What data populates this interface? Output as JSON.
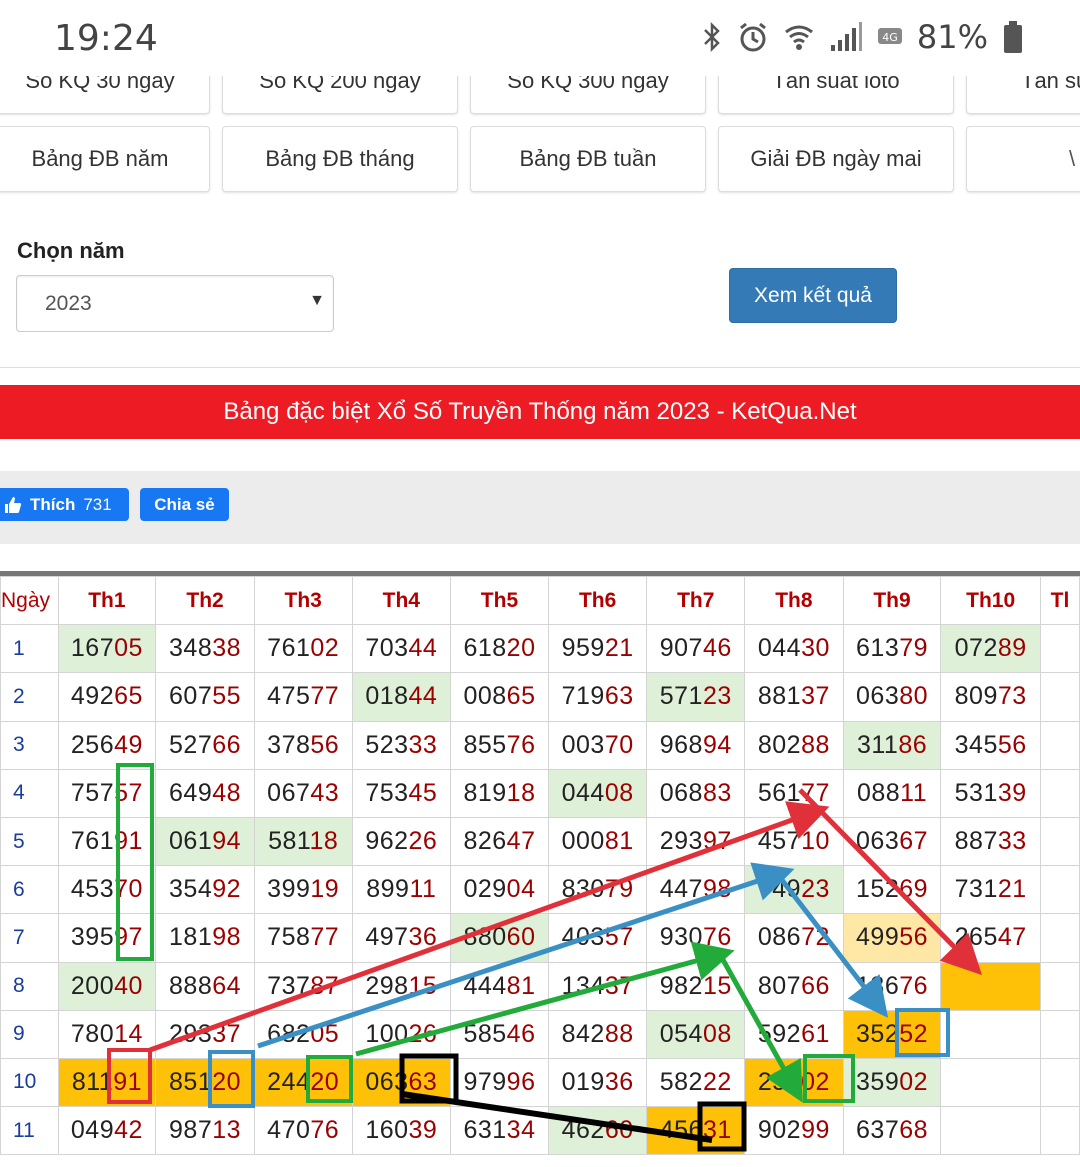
{
  "status_bar": {
    "time": "19:24",
    "battery": "81%",
    "icons": [
      "bluetooth-icon",
      "alarm-icon",
      "wifi-icon",
      "signal-icon",
      "4g-icon",
      "battery-icon"
    ]
  },
  "nav_buttons": {
    "row1": [
      "Số KQ 30 ngày",
      "Số KQ 200 ngày",
      "Số KQ 300 ngày",
      "Tần suất loto",
      "Tần su"
    ],
    "row2": [
      "Bảng ĐB năm",
      "Bảng ĐB tháng",
      "Bảng ĐB tuần",
      "Giải ĐB ngày mai",
      "\\"
    ]
  },
  "year_picker": {
    "label": "Chọn năm",
    "selected": "2023",
    "submit": "Xem kết quả"
  },
  "banner_title": "Bảng đặc biệt Xổ Số Truyền Thống năm 2023 - KetQua.Net",
  "social": {
    "like_label": "Thích",
    "like_count": "731",
    "share_label": "Chia sẻ"
  },
  "colors": {
    "banner": "#ed1c24",
    "header_text": "#b20000",
    "tail_digits": "#9b0000",
    "highlight_green": "#dff0d8",
    "highlight_orange": "#ffc107",
    "button_blue": "#337ab7",
    "facebook_blue": "#1877f2",
    "arrow_red": "#e0303a",
    "arrow_blue": "#3a8fc4",
    "arrow_green": "#22aa3a",
    "arrow_black": "#000000"
  },
  "table": {
    "headers": [
      "Ngày",
      "Th1",
      "Th2",
      "Th3",
      "Th4",
      "Th5",
      "Th6",
      "Th7",
      "Th8",
      "Th9",
      "Th10",
      "Tl"
    ],
    "rows": [
      {
        "day": "1",
        "values": [
          "16705",
          "34838",
          "76102",
          "70344",
          "61820",
          "95921",
          "90746",
          "04430",
          "61379",
          "07289",
          ""
        ]
      },
      {
        "day": "2",
        "values": [
          "49265",
          "60755",
          "47577",
          "01844",
          "00865",
          "71963",
          "57123",
          "88137",
          "06380",
          "80973",
          ""
        ]
      },
      {
        "day": "3",
        "values": [
          "25649",
          "52766",
          "37856",
          "52333",
          "85576",
          "00370",
          "96894",
          "80288",
          "31186",
          "34556",
          ""
        ]
      },
      {
        "day": "4",
        "values": [
          "75757",
          "64948",
          "06743",
          "75345",
          "81918",
          "04408",
          "06883",
          "56177",
          "08811",
          "53139",
          ""
        ]
      },
      {
        "day": "5",
        "values": [
          "76191",
          "06194",
          "58118",
          "96226",
          "82647",
          "00081",
          "29397",
          "45710",
          "06367",
          "88733",
          ""
        ]
      },
      {
        "day": "6",
        "values": [
          "45370",
          "35492",
          "39919",
          "89911",
          "02904",
          "83079",
          "44798",
          "74923",
          "15269",
          "73121",
          ""
        ]
      },
      {
        "day": "7",
        "values": [
          "39597",
          "18198",
          "75877",
          "49736",
          "88060",
          "40357",
          "93076",
          "08672",
          "49956",
          "26547",
          ""
        ]
      },
      {
        "day": "8",
        "values": [
          "20040",
          "88864",
          "73787",
          "29815",
          "44481",
          "13437",
          "98215",
          "80766",
          "13676",
          "",
          ""
        ]
      },
      {
        "day": "9",
        "values": [
          "78014",
          "29337",
          "68205",
          "10026",
          "58546",
          "84288",
          "05408",
          "59261",
          "35252",
          "",
          ""
        ]
      },
      {
        "day": "10",
        "values": [
          "81191",
          "85120",
          "24420",
          "06363",
          "97996",
          "01936",
          "58222",
          "25102",
          "35902",
          "",
          ""
        ]
      },
      {
        "day": "11",
        "values": [
          "04942",
          "98713",
          "47076",
          "16039",
          "63134",
          "46260",
          "45631",
          "90299",
          "63768",
          "",
          ""
        ]
      }
    ]
  }
}
